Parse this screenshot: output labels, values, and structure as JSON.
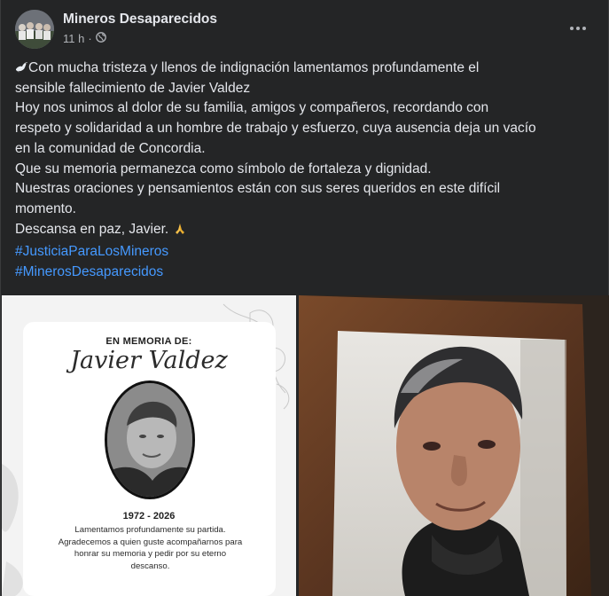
{
  "post": {
    "author": "Mineros Desaparecidos",
    "time": "11 h",
    "separator": "·",
    "privacy_icon": "globe-icon",
    "more_icon": "more-options-icon",
    "lines": [
      "Con mucha tristeza y llenos de indignación lamentamos profundamente el",
      "sensible fallecimiento de Javier Valdez",
      "Hoy nos unimos al dolor de su familia, amigos y compañeros, recordando con",
      "respeto y solidaridad a un hombre de trabajo y esfuerzo, cuya ausencia deja un vacío",
      "en la comunidad de Concordia.",
      "Que su memoria permanezca como símbolo de fortaleza y dignidad.",
      "Nuestras oraciones y pensamientos están con sus seres queridos en este difícil",
      "momento.",
      "Descansa en paz, Javier."
    ],
    "hashtags": [
      "#JusticiaParaLosMineros",
      "#MinerosDesaparecidos"
    ],
    "link_color": "#4599ff"
  },
  "memorial_card": {
    "heading": "EN MEMORIA DE:",
    "name": "Javier Valdez",
    "years": "1972 - 2026",
    "message_lines": [
      "Lamentamos profundamente su partida.",
      "Agradecemos a quien guste acompañarnos para",
      "honrar su memoria y pedir por su eterno",
      "descanso."
    ]
  }
}
